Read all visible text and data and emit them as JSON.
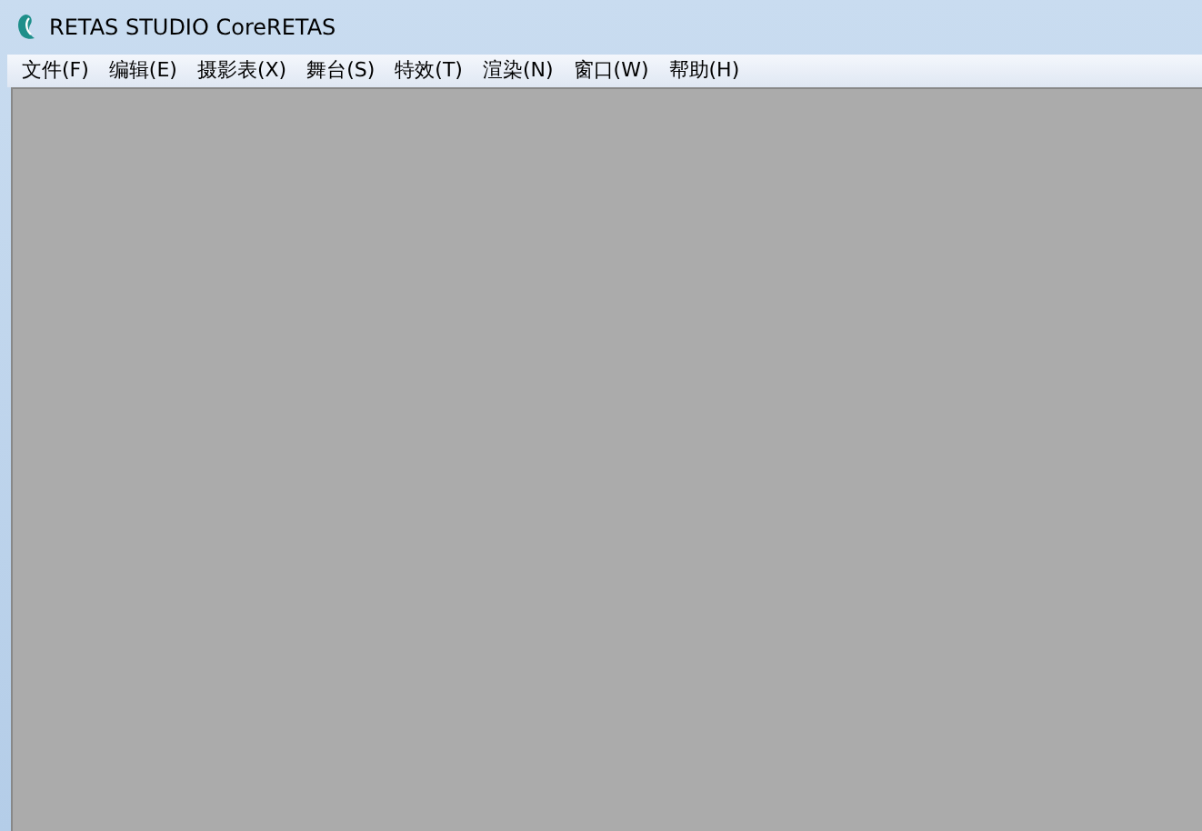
{
  "window": {
    "title": "RETAS STUDIO CoreRETAS"
  },
  "menu_bar": {
    "items": [
      "文件(F)",
      "编辑(E)",
      "摄影表(X)",
      "舞台(S)",
      "特效(T)",
      "渲染(N)",
      "窗口(W)",
      "帮助(H)"
    ]
  }
}
